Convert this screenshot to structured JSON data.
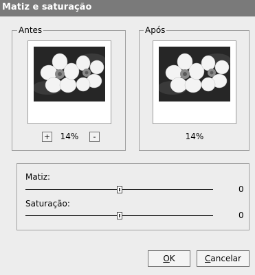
{
  "window": {
    "title": "Matiz e saturação"
  },
  "before": {
    "legend": "Antes",
    "zoom": "14%",
    "zoom_in": "+",
    "zoom_out": "-"
  },
  "after": {
    "legend": "Após",
    "zoom": "14%"
  },
  "adjustments": {
    "hue": {
      "label": "Matiz:",
      "value": "0",
      "level_fraction": 0.5
    },
    "saturation": {
      "label": "Saturação:",
      "value": "0",
      "level_fraction": 0.5
    }
  },
  "buttons": {
    "ok": {
      "mnemonic": "O",
      "rest": "K"
    },
    "cancel": {
      "mnemonic": "C",
      "rest": "ancelar"
    }
  }
}
